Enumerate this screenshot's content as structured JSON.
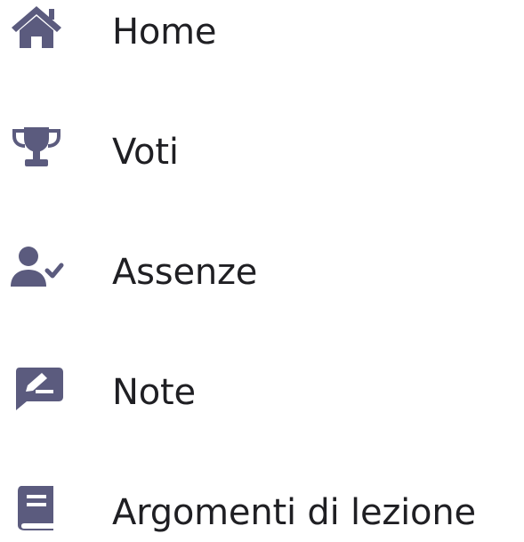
{
  "accent_color": "#5b5b7e",
  "text_color": "#1f1f23",
  "nav": {
    "items": [
      {
        "label": "Home",
        "icon": "home-icon"
      },
      {
        "label": "Voti",
        "icon": "trophy-icon"
      },
      {
        "label": "Assenze",
        "icon": "user-check-icon"
      },
      {
        "label": "Note",
        "icon": "note-edit-icon"
      },
      {
        "label": "Argomenti di lezione",
        "icon": "book-icon"
      }
    ]
  }
}
